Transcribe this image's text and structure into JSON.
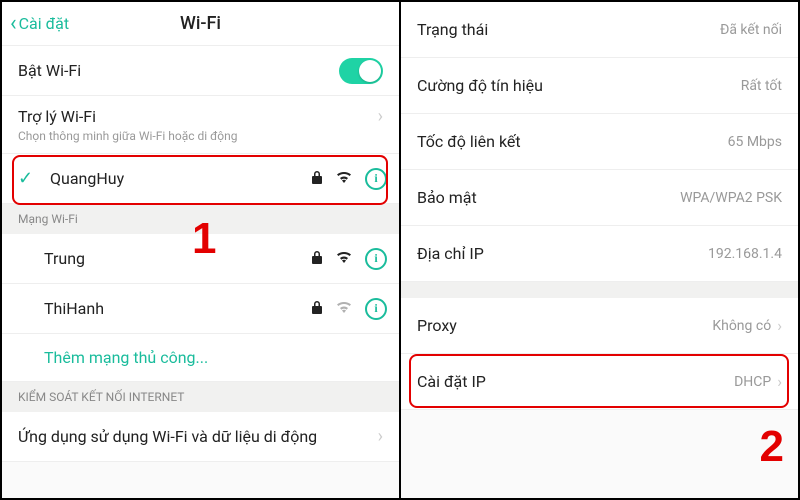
{
  "left": {
    "header": {
      "back": "Cài đặt",
      "title": "Wi-Fi"
    },
    "wifi_toggle_label": "Bật Wi-Fi",
    "assistant": {
      "label": "Trợ lý Wi-Fi",
      "sub": "Chọn thông minh giữa Wi-Fi hoặc di động"
    },
    "connected": {
      "name": "QuangHuy"
    },
    "section_networks": "Mạng Wi-Fi",
    "networks": [
      {
        "name": "Trung"
      },
      {
        "name": "ThiHanh"
      }
    ],
    "add_manual": "Thêm mạng thủ công...",
    "section_control": "KIỂM SOÁT KẾT NỐI INTERNET",
    "app_usage": "Ứng dụng sử dụng Wi-Fi và dữ liệu di động",
    "step": "1"
  },
  "right": {
    "status": {
      "k": "Trạng thái",
      "v": "Đã kết nối"
    },
    "signal": {
      "k": "Cường độ tín hiệu",
      "v": "Rất tốt"
    },
    "linkspeed": {
      "k": "Tốc độ liên kết",
      "v": "65 Mbps"
    },
    "security": {
      "k": "Bảo mật",
      "v": "WPA/WPA2 PSK"
    },
    "ip": {
      "k": "Địa chỉ IP",
      "v": "192.168.1.4"
    },
    "proxy": {
      "k": "Proxy",
      "v": "Không có"
    },
    "ipsettings": {
      "k": "Cài đặt IP",
      "v": "DHCP"
    },
    "step": "2"
  }
}
